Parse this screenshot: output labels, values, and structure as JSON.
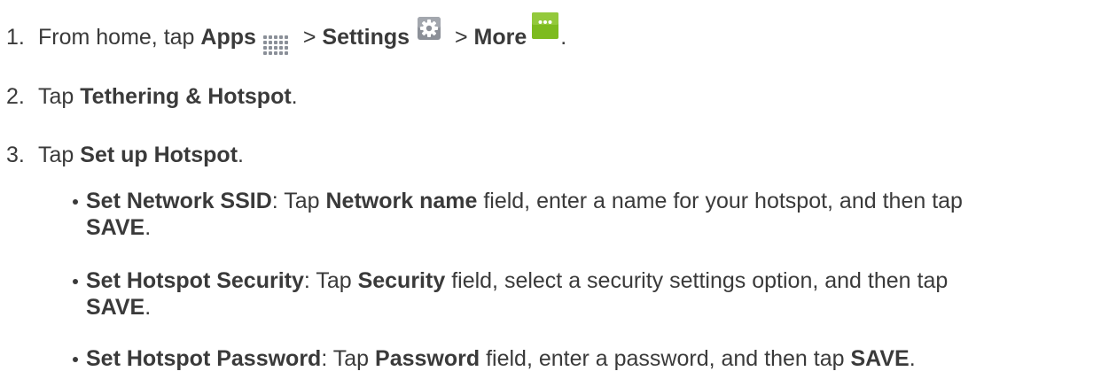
{
  "steps": [
    {
      "num": "1.",
      "parts": {
        "t1": "From home, tap ",
        "b1": "Apps",
        "t2": " > ",
        "b2": "Settings",
        "t3": " > ",
        "b3": "More",
        "t4": "."
      }
    },
    {
      "num": "2.",
      "parts": {
        "t1": "Tap ",
        "b1": "Tethering & Hotspot",
        "t2": "."
      }
    },
    {
      "num": "3.",
      "parts": {
        "t1": "Tap ",
        "b1": "Set up Hotspot",
        "t2": "."
      }
    }
  ],
  "bullets": [
    {
      "b1": "Set Network SSID",
      "t1": ": Tap ",
      "b2": "Network name",
      "t2": " field, enter a name for your hotspot, and then tap",
      "b3": "SAVE",
      "t3": "."
    },
    {
      "b1": "Set Hotspot Security",
      "t1": ": Tap ",
      "b2": "Security",
      "t2": " field, select a security settings option, and then tap",
      "b3": "SAVE",
      "t3": "."
    },
    {
      "b1": "Set Hotspot Password",
      "t1": ": Tap ",
      "b2": "Password",
      "t2": " field, enter a password, and then tap ",
      "b3": "SAVE",
      "t3": "."
    }
  ],
  "icons": {
    "apps": "apps-grid-icon",
    "settings": "settings-gear-icon",
    "more": "more-dots-icon"
  },
  "colors": {
    "text": "#3a3a3a",
    "apps_icon": "#8a8f98",
    "settings_icon": "#8c9098",
    "more_icon": "#7dbb1f"
  }
}
